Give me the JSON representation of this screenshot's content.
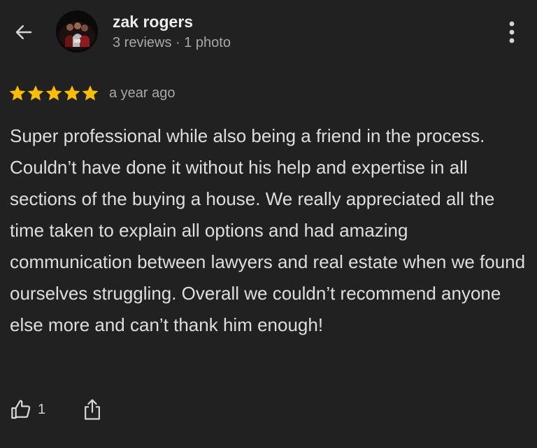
{
  "header": {
    "back_icon": "arrow-left-icon",
    "reviewer_name": "zak rogers",
    "reviewer_stats": "3 reviews · 1 photo",
    "more_icon": "more-vertical-icon"
  },
  "review": {
    "rating": 5,
    "rating_max": 5,
    "date": "a year ago",
    "text": "Super professional while also being a friend in the process. Couldn’t have done it without his help and expertise in all sections of the buying a house. We really appreciated all the time taken to explain all options and had amazing communication between lawyers and real estate when we found ourselves struggling. Overall we couldn’t recommend anyone else more and can’t thank him enough!"
  },
  "actions": {
    "like_icon": "thumbs-up-icon",
    "like_count": "1",
    "share_icon": "share-icon"
  },
  "colors": {
    "background": "#212121",
    "star": "#fbbc04",
    "primary_text": "#e3e3e3",
    "secondary_text": "#a8a8a8"
  }
}
